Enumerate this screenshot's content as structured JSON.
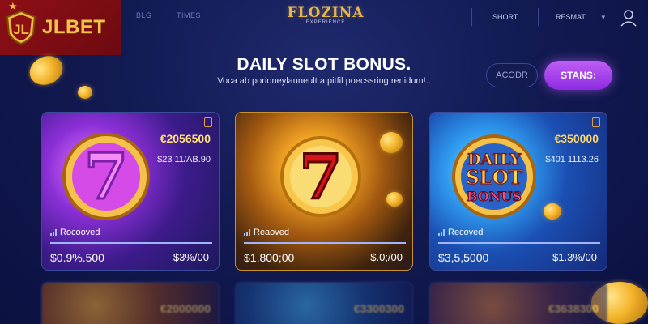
{
  "brand": {
    "name": "JLBET",
    "badge": "JL"
  },
  "nav": {
    "left": [
      "BLG",
      "TIMES"
    ],
    "logo_main": "FLOZINA",
    "logo_sub": "EXPERIENCE",
    "right": [
      "SHORT",
      "RESMAT"
    ]
  },
  "hero": {
    "title": "DAILY SLOT BONUS.",
    "subtitle": "Voca ab porioneylauneult a pitfil poecssring renidum!..",
    "secondary_button": "ACODR",
    "primary_button": "STANS:"
  },
  "cards": [
    {
      "value": "€2056500",
      "sub": "$23 11/AB.90",
      "status": "Rocooved",
      "progress": 1.0,
      "foot_left": "$0.9%.500",
      "foot_right": "$3%/00"
    },
    {
      "value": "",
      "sub": "",
      "status": "Reaoved",
      "progress": 1.0,
      "foot_left": "$1.800;00",
      "foot_right": "$.0;/00"
    },
    {
      "value": "€350000",
      "sub": "$401 1113.26",
      "status": "Recoved",
      "progress": 1.0,
      "foot_left": "$3,5,5000",
      "foot_right": "$1.3%/00"
    },
    {
      "value": "€2000000"
    },
    {
      "value": "€3300300"
    },
    {
      "value": "€3638300"
    }
  ],
  "art": {
    "card1": "purple seven slot icon",
    "card2": "gold seven slot icon",
    "card3_text": [
      "DAILY",
      "SLOT",
      "BONUS"
    ]
  },
  "colors": {
    "accent_purple": "#a347ee",
    "gold": "#f1b843",
    "brand_red": "#8e0f16",
    "background": "#121a52"
  }
}
